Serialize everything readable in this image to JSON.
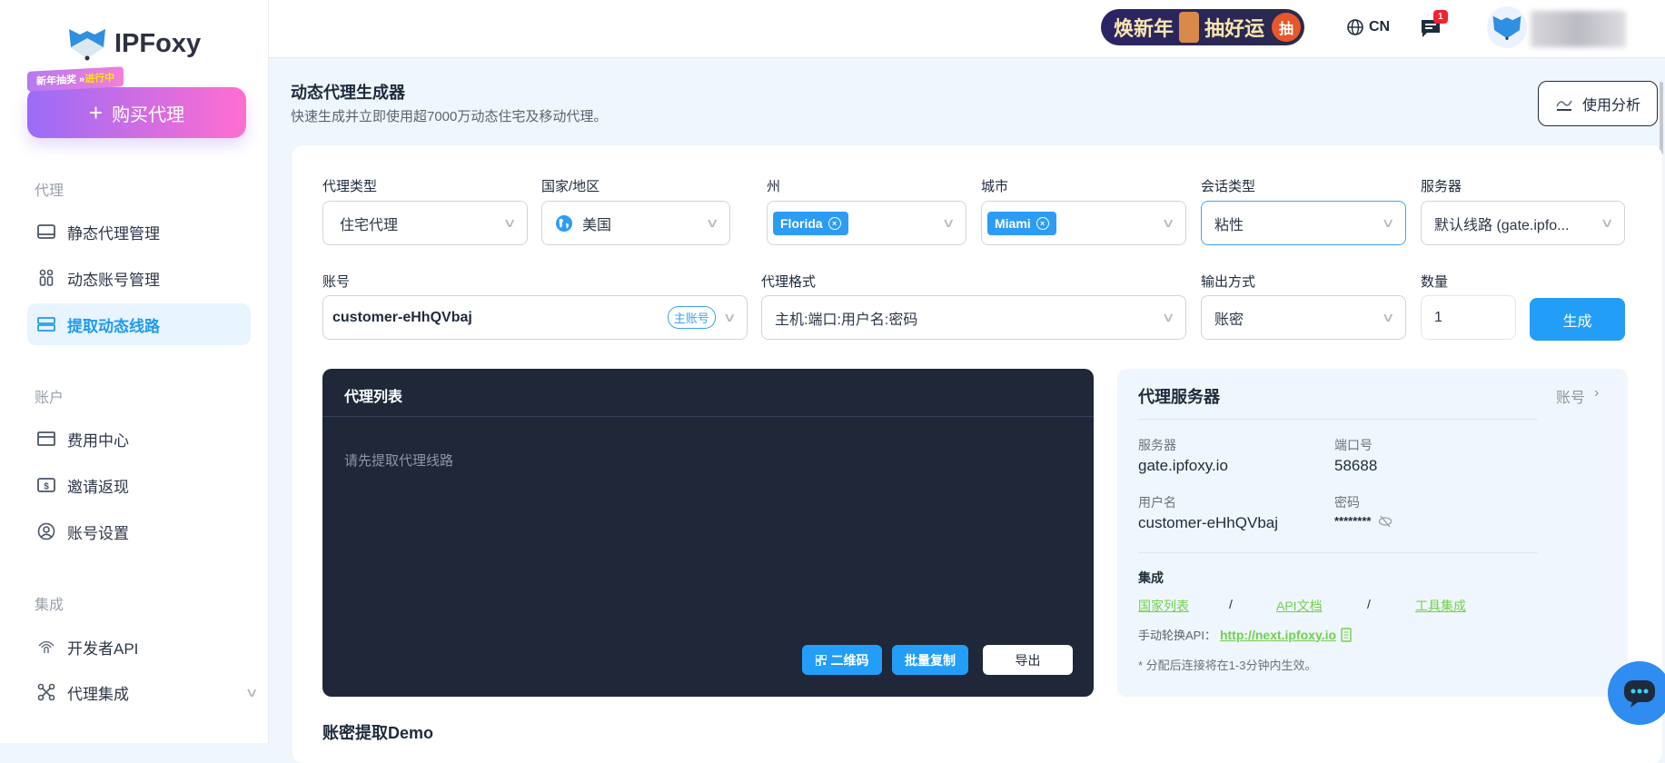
{
  "brand": {
    "name": "IPFoxy",
    "promo_prefix": "新年抽奖 »",
    "promo_status": "进行中",
    "buy_label": "购买代理"
  },
  "sidebar": {
    "sections": [
      {
        "title": "代理",
        "items": [
          {
            "label": "静态代理管理",
            "icon": "monitor-icon"
          },
          {
            "label": "动态账号管理",
            "icon": "users-icon"
          },
          {
            "label": "提取动态线路",
            "icon": "server-icon",
            "active": true
          }
        ]
      },
      {
        "title": "账户",
        "items": [
          {
            "label": "费用中心",
            "icon": "card-icon"
          },
          {
            "label": "邀请返现",
            "icon": "dollar-icon"
          },
          {
            "label": "账号设置",
            "icon": "user-circle-icon"
          }
        ]
      },
      {
        "title": "集成",
        "items": [
          {
            "label": "开发者API",
            "icon": "fingerprint-icon"
          },
          {
            "label": "代理集成",
            "icon": "integration-icon"
          }
        ]
      }
    ]
  },
  "topbar": {
    "banner_text_1": "焕新年",
    "banner_text_2": "抽好运",
    "banner_button": "抽",
    "language": "CN",
    "notification_count": "1"
  },
  "page": {
    "title": "动态代理生成器",
    "subtitle": "快速生成并立即使用超7000万动态住宅及移动代理。",
    "analysis_button": "使用分析"
  },
  "form": {
    "proxy_type": {
      "label": "代理类型",
      "value": "住宅代理"
    },
    "country": {
      "label": "国家/地区",
      "value": "美国"
    },
    "state": {
      "label": "州",
      "tag": "Florida"
    },
    "city": {
      "label": "城市",
      "tag": "Miami"
    },
    "session": {
      "label": "会话类型",
      "value": "粘性"
    },
    "server": {
      "label": "服务器",
      "value": "默认线路 (gate.ipfo..."
    },
    "account": {
      "label": "账号",
      "value": "customer-eHhQVbaj",
      "badge": "主账号"
    },
    "format": {
      "label": "代理格式",
      "value": "主机:端口:用户名:密码"
    },
    "output": {
      "label": "输出方式",
      "value": "账密"
    },
    "quantity": {
      "label": "数量",
      "value": "1"
    },
    "generate_button": "生成"
  },
  "proxy_list": {
    "title": "代理列表",
    "placeholder": "请先提取代理线路",
    "qr_button": "二维码",
    "copy_button": "批量复制",
    "export_button": "导出"
  },
  "server_info": {
    "title": "代理服务器",
    "account_link": "账号",
    "server_label": "服务器",
    "server_value": "gate.ipfoxy.io",
    "port_label": "端口号",
    "port_value": "58688",
    "user_label": "用户名",
    "user_value": "customer-eHhQVbaj",
    "password_label": "密码",
    "password_value": "********",
    "integration_title": "集成",
    "links": [
      "国家列表",
      "API文档",
      "工具集成"
    ],
    "separator": "/",
    "rotate_label": "手动轮换API：",
    "rotate_url": "http://next.ipfoxy.io",
    "note": "* 分配后连接将在1-3分钟内生效。"
  },
  "demo": {
    "title": "账密提取Demo"
  },
  "colors": {
    "accent": "#229ef8",
    "dark_panel": "#1f2739",
    "link": "#6fd14c"
  }
}
